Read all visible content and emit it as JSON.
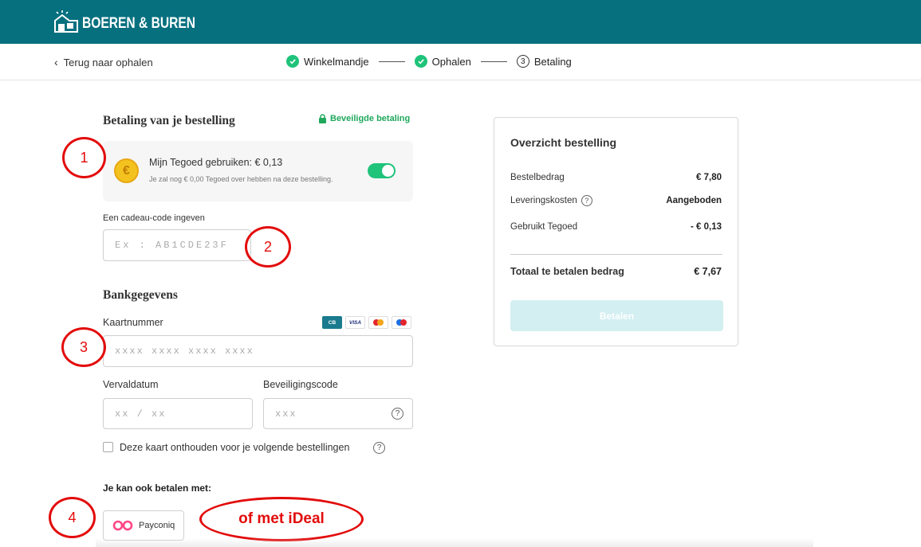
{
  "header": {
    "logo_text": "BOEREN & BUREN",
    "brand_color": "#06707f"
  },
  "subnav": {
    "back_label": "Terug naar ophalen",
    "steps": [
      {
        "label": "Winkelmandje",
        "state": "done"
      },
      {
        "label": "Ophalen",
        "state": "done"
      },
      {
        "label": "Betaling",
        "state": "current",
        "number": "3"
      }
    ]
  },
  "payment": {
    "title": "Betaling van je bestelling",
    "secure_label": "Beveiligde betaling",
    "tegoed": {
      "main": "Mijn Tegoed gebruiken: € 0,13",
      "sub": "Je zal nog € 0,00 Tegoed over hebben na deze bestelling.",
      "toggle_on": true,
      "coin_symbol": "€"
    },
    "gift_label": "Een cadeau-code ingeven",
    "gift_placeholder": "Ex : AB1CDE23F"
  },
  "bank": {
    "title": "Bankgegevens",
    "card_label": "Kaartnummer",
    "card_placeholder": "xxxx xxxx xxxx xxxx",
    "card_brands": [
      "CB",
      "VISA",
      "Maestro",
      "Mastercard"
    ],
    "cb_label": "CB",
    "visa_label": "VISA",
    "expiry_label": "Vervaldatum",
    "expiry_placeholder": "xx / xx",
    "cvc_label": "Beveiligingscode",
    "cvc_placeholder": "xxx",
    "help_symbol": "?",
    "remember_label": "Deze kaart onthouden voor je volgende bestellingen"
  },
  "alternatives": {
    "label": "Je kan ook betalen met:",
    "payconiq_label": "Payconiq"
  },
  "summary": {
    "title": "Overzicht bestelling",
    "rows": [
      {
        "label": "Bestelbedrag",
        "value": "€ 7,80"
      },
      {
        "label": "Leveringskosten",
        "value": "Aangeboden",
        "help": true
      },
      {
        "label": "Gebruikt Tegoed",
        "value": "- € 0,13"
      }
    ],
    "total_label": "Totaal te betalen bedrag",
    "total_value": "€ 7,67",
    "pay_button": "Betalen"
  },
  "annotations": {
    "one": "1",
    "two": "2",
    "three": "3",
    "four": "4",
    "ideal_note": "of met iDeal",
    "color": "#e30b0b"
  }
}
